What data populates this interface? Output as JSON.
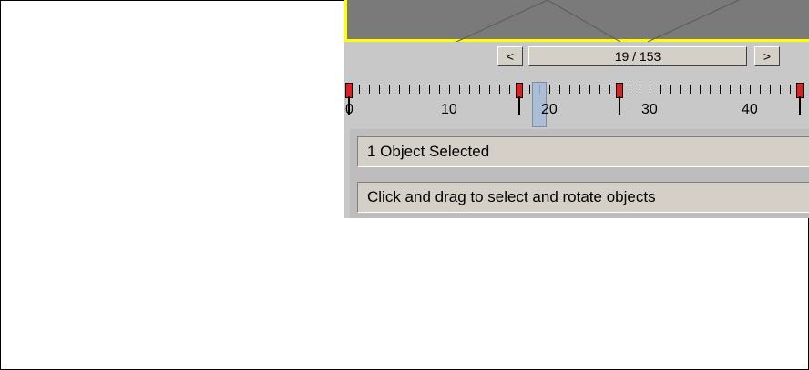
{
  "viewport": {
    "border_color": "#ffff00",
    "bg_color": "#7a7a7a"
  },
  "time_slider": {
    "prev_label": "<",
    "frame_label": "19 / 153",
    "next_label": ">",
    "current_frame": 19,
    "total_frames": 153
  },
  "timeline": {
    "labels": [
      "0",
      "10",
      "20",
      "30",
      "40"
    ],
    "key_frames": [
      0,
      17,
      27,
      45
    ],
    "key_color": "#e02020"
  },
  "status": {
    "selection_text": "1 Object Selected",
    "prompt_text": "Click and drag to select and rotate objects"
  }
}
